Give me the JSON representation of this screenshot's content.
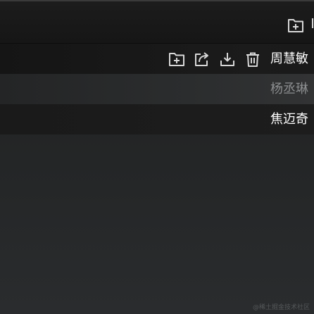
{
  "toolbar": {
    "new_folder_icon": "folder-plus-icon"
  },
  "list": {
    "items": [
      {
        "label": "周慧敏",
        "state": "active",
        "actions": [
          {
            "icon": "folder-plus-icon"
          },
          {
            "icon": "share-icon"
          },
          {
            "icon": "download-icon"
          },
          {
            "icon": "trash-icon"
          }
        ]
      },
      {
        "label": "杨丞琳",
        "state": "muted"
      },
      {
        "label": "焦迈奇",
        "state": "normal"
      }
    ]
  },
  "watermark": "@稀土掘金技术社区",
  "colors": {
    "background": "#232526",
    "active_row": "#1b1b1b",
    "text_primary": "#ffffff",
    "text_muted": "#8c8e90",
    "icon": "#d8d8d8"
  }
}
